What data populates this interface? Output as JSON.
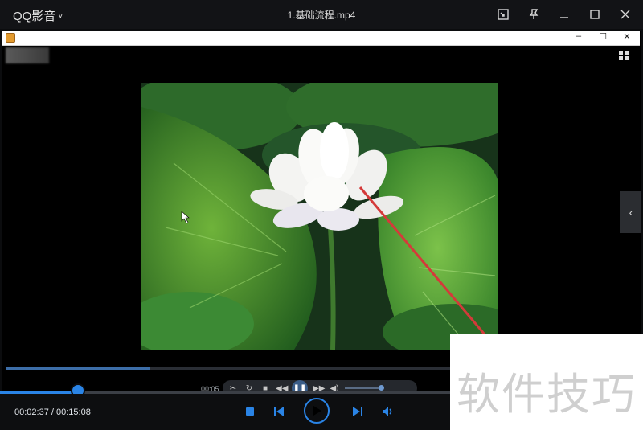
{
  "app": {
    "name": "QQ影音",
    "menu_chevron": "˅"
  },
  "window": {
    "file_title": "1.基础流程.mp4"
  },
  "titlebar_icons": [
    "mini-mode-icon",
    "pin-icon",
    "minimize-icon",
    "maximize-icon",
    "close-icon"
  ],
  "inner_window": {
    "controls": [
      "–",
      "☐",
      "✕"
    ]
  },
  "inner_player": {
    "time_label": "00:05",
    "side_arrow": "‹"
  },
  "playback": {
    "current_time": "00:02:37",
    "separator": " / ",
    "total_time": "00:15:08",
    "progress_fraction": 0.173
  },
  "watermark": {
    "text": "软件技巧"
  },
  "colors": {
    "accent": "#2a84e6",
    "background": "#0b0c0e"
  }
}
